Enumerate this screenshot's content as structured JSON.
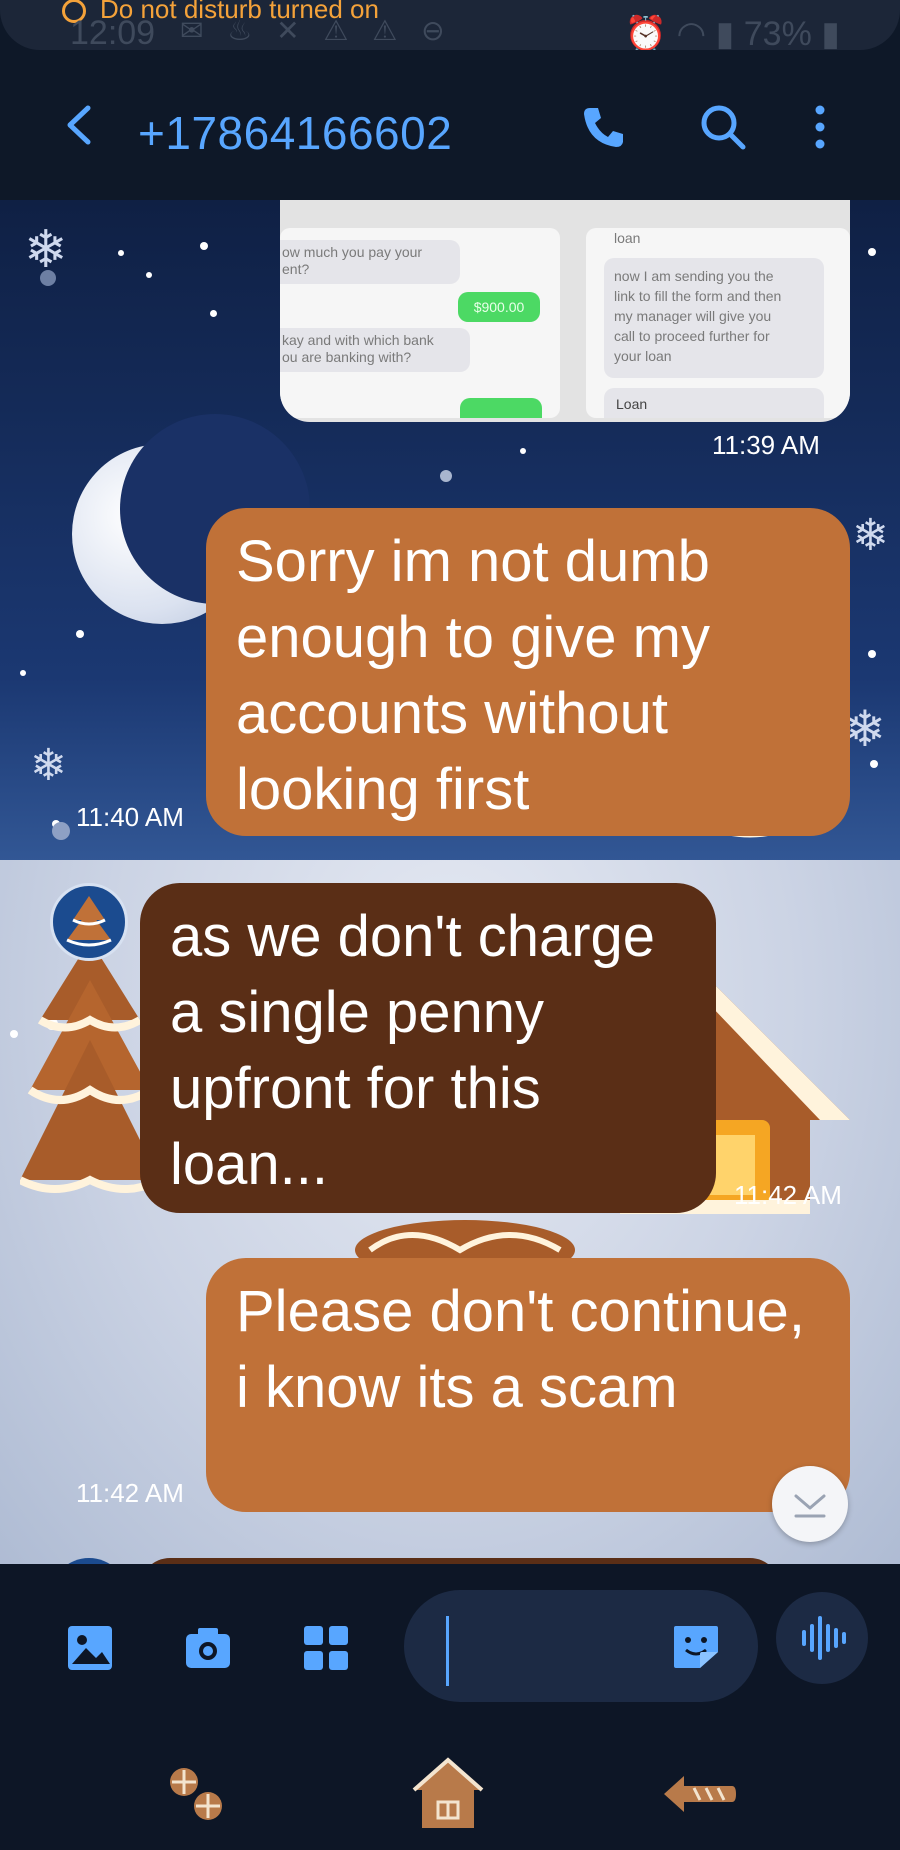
{
  "status_bar": {
    "notice": "Do not disturb turned on",
    "time": "12:09",
    "battery": "73%",
    "icons": [
      "chat-bubble-icon",
      "app-icon",
      "notification-icon",
      "warning-icon",
      "warning-icon",
      "key-icon",
      "alarm-icon",
      "wifi-icon",
      "signal-icon",
      "battery-icon"
    ]
  },
  "header": {
    "title": "+17864166602",
    "icons": [
      "back-arrow-icon",
      "phone-icon",
      "search-icon",
      "more-vertical-icon"
    ]
  },
  "conversation": {
    "image_message": {
      "time": "11:39 AM",
      "left_shot": {
        "texts": [
          "ow much you pay your",
          "ent?",
          "$900.00",
          "kay and with which bank",
          "ou are banking with?"
        ]
      },
      "right_shot": {
        "texts": [
          "loan",
          "now I am sending you the",
          "link to fill the form and then",
          "my manager will give you",
          "call to proceed further for",
          "your loan",
          "Loan"
        ]
      }
    },
    "messages": [
      {
        "direction": "outgoing",
        "text": "Sorry im not dumb enough to give my accounts without looking first",
        "time": "11:40 AM"
      },
      {
        "direction": "incoming",
        "text": "as we don't charge a single penny upfront for this loan...",
        "time": "11:42 AM"
      },
      {
        "direction": "outgoing",
        "text": "Please don't continue, i know its a scam",
        "time": "11:42 AM"
      }
    ]
  },
  "composer": {
    "icons": [
      "gallery-icon",
      "camera-icon",
      "apps-grid-icon",
      "sticker-icon",
      "voice-wave-icon"
    ],
    "value": ""
  },
  "nav_bar": {
    "icons": [
      "recents-snowflake-icon",
      "home-gingerbread-house-icon",
      "back-arrow-icon"
    ]
  },
  "colors": {
    "accent": "#58a6ff",
    "outgoing_bubble": "#c07138",
    "incoming_bubble": "#5a2e16",
    "dnd": "#f4a23a"
  }
}
